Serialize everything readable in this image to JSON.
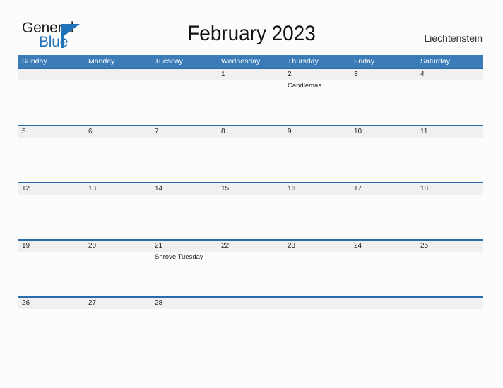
{
  "brand": {
    "name_part1": "General",
    "name_part2": "Blue",
    "mark_icon": "triangle-flag-icon",
    "color_dark": "#1d1d1d",
    "color_blue": "#1f72b8"
  },
  "header": {
    "title": "February 2023",
    "country": "Liechtenstein"
  },
  "theme": {
    "header_bar": "#3b7cb8",
    "week_rule": "#2a6ca8",
    "day_band": "#f0f0f0",
    "page_bg": "#fcfcfc",
    "text": "#262626"
  },
  "calendar": {
    "weekdays": [
      "Sunday",
      "Monday",
      "Tuesday",
      "Wednesday",
      "Thursday",
      "Friday",
      "Saturday"
    ],
    "weeks": [
      [
        {
          "day": "",
          "events": []
        },
        {
          "day": "",
          "events": []
        },
        {
          "day": "",
          "events": []
        },
        {
          "day": "1",
          "events": []
        },
        {
          "day": "2",
          "events": [
            "Candlemas"
          ]
        },
        {
          "day": "3",
          "events": []
        },
        {
          "day": "4",
          "events": []
        }
      ],
      [
        {
          "day": "5",
          "events": []
        },
        {
          "day": "6",
          "events": []
        },
        {
          "day": "7",
          "events": []
        },
        {
          "day": "8",
          "events": []
        },
        {
          "day": "9",
          "events": []
        },
        {
          "day": "10",
          "events": []
        },
        {
          "day": "11",
          "events": []
        }
      ],
      [
        {
          "day": "12",
          "events": []
        },
        {
          "day": "13",
          "events": []
        },
        {
          "day": "14",
          "events": []
        },
        {
          "day": "15",
          "events": []
        },
        {
          "day": "16",
          "events": []
        },
        {
          "day": "17",
          "events": []
        },
        {
          "day": "18",
          "events": []
        }
      ],
      [
        {
          "day": "19",
          "events": []
        },
        {
          "day": "20",
          "events": []
        },
        {
          "day": "21",
          "events": [
            "Shrove Tuesday"
          ]
        },
        {
          "day": "22",
          "events": []
        },
        {
          "day": "23",
          "events": []
        },
        {
          "day": "24",
          "events": []
        },
        {
          "day": "25",
          "events": []
        }
      ],
      [
        {
          "day": "26",
          "events": []
        },
        {
          "day": "27",
          "events": []
        },
        {
          "day": "28",
          "events": []
        },
        {
          "day": "",
          "events": []
        },
        {
          "day": "",
          "events": []
        },
        {
          "day": "",
          "events": []
        },
        {
          "day": "",
          "events": []
        }
      ]
    ]
  }
}
